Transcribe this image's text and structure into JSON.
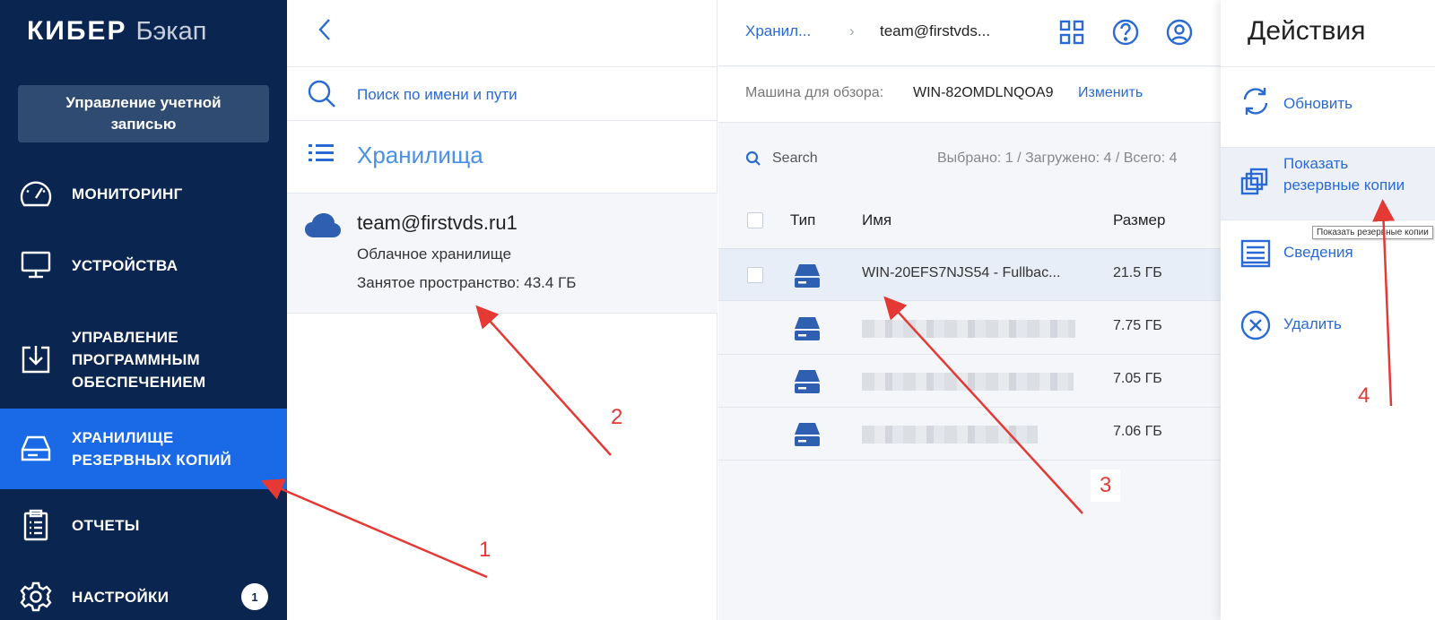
{
  "sidebar": {
    "logo_main": "КИБЕР",
    "logo_sub": "Бэкап",
    "account_button": "Управление учетной записью",
    "items": [
      {
        "label": "МОНИТОРИНГ",
        "icon": "gauge-icon"
      },
      {
        "label": "УСТРОЙСТВА",
        "icon": "monitor-icon"
      },
      {
        "label": "УПРАВЛЕНИЕ ПРОГРАММНЫМ ОБЕСПЕЧЕНИЕМ",
        "icon": "software-install-icon"
      },
      {
        "label": "ХРАНИЛИЩЕ РЕЗЕРВНЫХ КОПИЙ",
        "icon": "drive-icon",
        "active": true
      },
      {
        "label": "ОТЧЕТЫ",
        "icon": "clipboard-icon"
      },
      {
        "label": "НАСТРОЙКИ",
        "icon": "gear-icon",
        "badge": "1"
      }
    ]
  },
  "storage_panel": {
    "search_placeholder": "Поиск по имени и пути",
    "section_title": "Хранилища",
    "storage": {
      "name": "team@firstvds.ru1",
      "type": "Облачное хранилище",
      "used": "Занятое пространство: 43.4 ГБ"
    }
  },
  "backups_panel": {
    "breadcrumb": [
      "Хранил...",
      "team@firstvds..."
    ],
    "machine_label": "Машина для обзора:",
    "machine_value": "WIN-82OMDLNQOA9",
    "machine_change": "Изменить",
    "search_placeholder": "Search",
    "counter": "Выбрано: 1 / Загружено: 4 / Всего: 4",
    "columns": [
      "Тип",
      "Имя",
      "Размер"
    ],
    "rows": [
      {
        "name": "WIN-20EFS7NJS54 - Fullbac...",
        "size": "21.5 ГБ",
        "selected": true
      },
      {
        "name": "",
        "size": "7.75 ГБ",
        "blurred": true
      },
      {
        "name": "",
        "size": "7.05 ГБ",
        "blurred": true
      },
      {
        "name": "",
        "size": "7.06 ГБ",
        "blurred": true
      }
    ]
  },
  "actions_panel": {
    "title": "Действия",
    "items": [
      {
        "label": "Обновить",
        "icon": "refresh-icon"
      },
      {
        "label": "Показать резервные копии",
        "icon": "copies-icon",
        "active": true
      },
      {
        "label": "Сведения",
        "icon": "details-icon"
      },
      {
        "label": "Удалить",
        "icon": "delete-icon"
      }
    ],
    "tooltip": "Показать резервные копии"
  },
  "annotations": {
    "markers": [
      "1",
      "2",
      "3",
      "4"
    ],
    "color": "#e53935"
  },
  "colors": {
    "sidebar_bg": "#0b2551",
    "active_nav": "#1a6ae8",
    "link_blue": "#2a6ad4"
  }
}
